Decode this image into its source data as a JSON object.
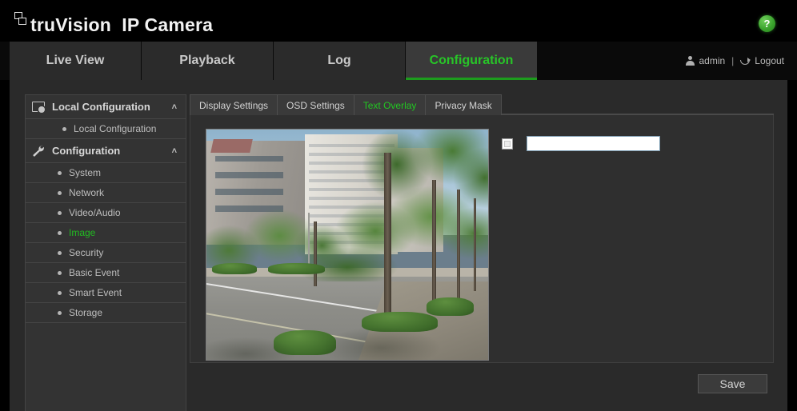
{
  "header": {
    "brand": "truVision  IP Camera",
    "brand_icon": "stacked-squares-logo-icon",
    "help_label": "?",
    "help_color": "#3ba52c"
  },
  "nav": {
    "tabs": [
      {
        "label": "Live View",
        "active": false
      },
      {
        "label": "Playback",
        "active": false
      },
      {
        "label": "Log",
        "active": false
      },
      {
        "label": "Configuration",
        "active": true
      }
    ],
    "active_color": "#28c328",
    "user": "admin",
    "separator": "|",
    "logout": "Logout"
  },
  "sidebar": {
    "groups": [
      {
        "label": "Local Configuration",
        "icon": "monitor-gear-icon",
        "caret": "˄",
        "items": [
          {
            "label": "Local Configuration",
            "active": false
          }
        ]
      },
      {
        "label": "Configuration",
        "icon": "wrench-icon",
        "caret": "˄",
        "items": [
          {
            "label": "System",
            "active": false
          },
          {
            "label": "Network",
            "active": false
          },
          {
            "label": "Video/Audio",
            "active": false
          },
          {
            "label": "Image",
            "active": true
          },
          {
            "label": "Security",
            "active": false
          },
          {
            "label": "Basic Event",
            "active": false
          },
          {
            "label": "Smart Event",
            "active": false
          },
          {
            "label": "Storage",
            "active": false
          }
        ]
      }
    ]
  },
  "content": {
    "tabs": [
      {
        "label": "Display Settings",
        "active": false
      },
      {
        "label": "OSD Settings",
        "active": false
      },
      {
        "label": "Text Overlay",
        "active": true
      },
      {
        "label": "Privacy Mask",
        "active": false
      }
    ],
    "preview": {
      "name": "live-video-preview",
      "description": "street scene with apartment buildings, trees and hedges"
    },
    "text_overlay": {
      "checkbox_checked": false,
      "text_value": "",
      "text_placeholder": ""
    },
    "save_label": "Save"
  }
}
